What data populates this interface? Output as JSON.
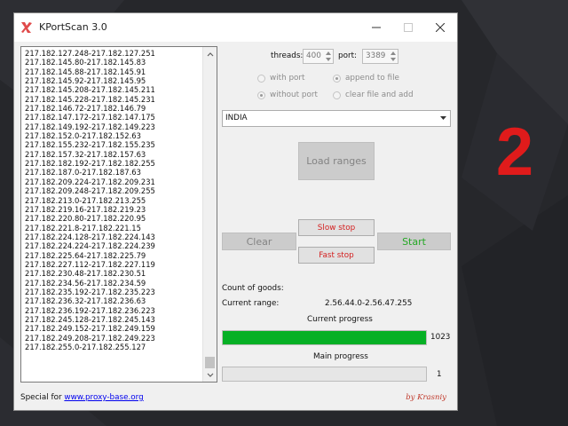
{
  "window": {
    "title": "KPortScan 3.0"
  },
  "ip_list": [
    "217.182.127.248-217.182.127.251",
    "217.182.145.80-217.182.145.83",
    "217.182.145.88-217.182.145.91",
    "217.182.145.92-217.182.145.95",
    "217.182.145.208-217.182.145.211",
    "217.182.145.228-217.182.145.231",
    "217.182.146.72-217.182.146.79",
    "217.182.147.172-217.182.147.175",
    "217.182.149.192-217.182.149.223",
    "217.182.152.0-217.182.152.63",
    "217.182.155.232-217.182.155.235",
    "217.182.157.32-217.182.157.63",
    "217.182.182.192-217.182.182.255",
    "217.182.187.0-217.182.187.63",
    "217.182.209.224-217.182.209.231",
    "217.182.209.248-217.182.209.255",
    "217.182.213.0-217.182.213.255",
    "217.182.219.16-217.182.219.23",
    "217.182.220.80-217.182.220.95",
    "217.182.221.8-217.182.221.15",
    "217.182.224.128-217.182.224.143",
    "217.182.224.224-217.182.224.239",
    "217.182.225.64-217.182.225.79",
    "217.182.227.112-217.182.227.119",
    "217.182.230.48-217.182.230.51",
    "217.182.234.56-217.182.234.59",
    "217.182.235.192-217.182.235.223",
    "217.182.236.32-217.182.236.63",
    "217.182.236.192-217.182.236.223",
    "217.182.245.128-217.182.245.143",
    "217.182.249.152-217.182.249.159",
    "217.182.249.208-217.182.249.223",
    "217.182.255.0-217.182.255.127"
  ],
  "settings": {
    "threads_label": "threads:",
    "threads_value": "400",
    "port_label": "port:",
    "port_value": "3389",
    "with_port_label": "with port",
    "without_port_label": "without port",
    "append_label": "append to file",
    "clear_add_label": "clear file and add"
  },
  "country": {
    "selected": "INDIA"
  },
  "buttons": {
    "load_ranges": "Load ranges",
    "slow_stop": "Slow stop",
    "fast_stop": "Fast stop",
    "clear": "Clear",
    "start": "Start"
  },
  "status": {
    "count_label": "Count of goods:",
    "current_range_label": "Current range:",
    "current_range_value": "2.56.44.0-2.56.47.255",
    "current_progress_label": "Current progress",
    "current_progress_value": "1023",
    "current_progress_fraction": 1.0,
    "main_progress_label": "Main progress",
    "main_progress_value": "1",
    "main_progress_fraction": 0.0
  },
  "footer": {
    "special_label": "Special for",
    "link_text": "www.proxy-base.org",
    "credit": "by Krasniy"
  },
  "overlay_number": "2",
  "colors": {
    "progress_green": "#06b025",
    "start_green": "#25a825",
    "stop_red": "#d42020",
    "overlay_red": "#e01b1b"
  }
}
